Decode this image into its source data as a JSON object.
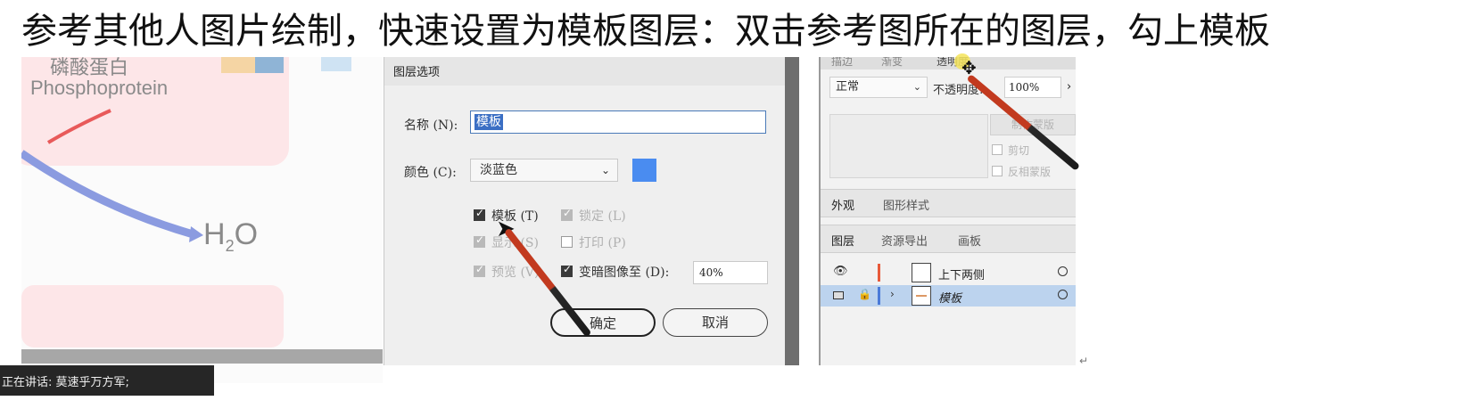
{
  "caption": "参考其他人图片绘制，快速设置为模板图层：双击参考图所在的图层，勾上模板",
  "illustration": {
    "label_cn": "磷酸蛋白",
    "label_en": "Phosphoprotein",
    "h2o_main": "H",
    "h2o_sub": "2",
    "h2o_tail": "O"
  },
  "dialog": {
    "title": "图层选项",
    "name_label": "名称 (N):",
    "name_value": "模板",
    "color_label": "颜色 (C):",
    "color_value": "淡蓝色",
    "swatch_color": "#4a8cf0",
    "checkboxes": {
      "template": "模板 (T)",
      "lock": "锁定 (L)",
      "show": "显示 (S)",
      "print": "打印 (P)",
      "preview": "预览 (V)",
      "dim": "变暗图像至 (D):"
    },
    "dim_value": "40%",
    "ok": "确定",
    "cancel": "取消"
  },
  "panels": {
    "top_tabs": [
      "描边",
      "渐变",
      "透明度"
    ],
    "blend_mode": "正常",
    "opacity_label": "不透明度:",
    "opacity_value": "100%",
    "make_mask": "制作蒙版",
    "clip": "剪切",
    "invert_mask": "反相蒙版",
    "appearance_tabs": [
      "外观",
      "图形样式"
    ],
    "layer_tabs": [
      "图层",
      "资源导出",
      "画板"
    ],
    "layers": [
      {
        "name": "上下两侧",
        "color": "#e85a3a"
      },
      {
        "name": "模板",
        "color": "#4a7ad8"
      }
    ]
  },
  "status_text": "正在讲话: 莫速乎万方军;",
  "tail_mark": "↵"
}
